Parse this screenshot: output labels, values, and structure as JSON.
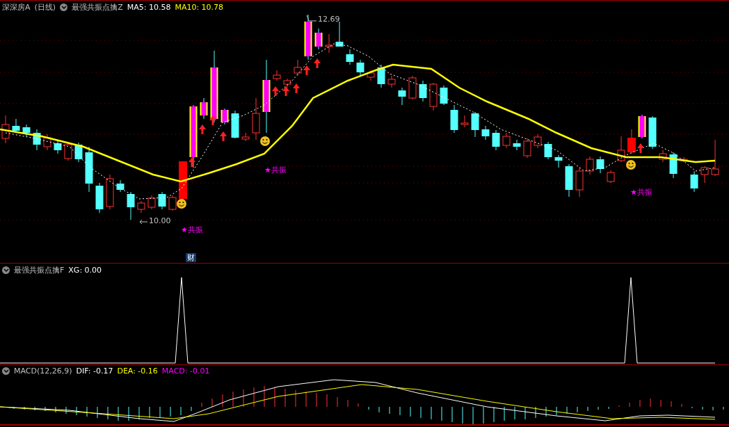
{
  "main_panel": {
    "stock_name": "深深房A",
    "period": "(日线)",
    "indicator": "最强共振点擒Z",
    "ma5": "MA5: 10.58",
    "ma10": "MA10: 10.78",
    "high_marker": "12.69",
    "low_marker": "10.00",
    "signals": [
      "★共振",
      "★共振",
      "★共振"
    ],
    "badge": "财"
  },
  "signal_panel": {
    "indicator": "最强共振点擒F",
    "value": "XG: 0.00"
  },
  "macd_panel": {
    "indicator": "MACD(12,26,9)",
    "dif": "DIF: -0.17",
    "dea": "DEA: -0.16",
    "macd": "MACD: -0.01"
  }
}
